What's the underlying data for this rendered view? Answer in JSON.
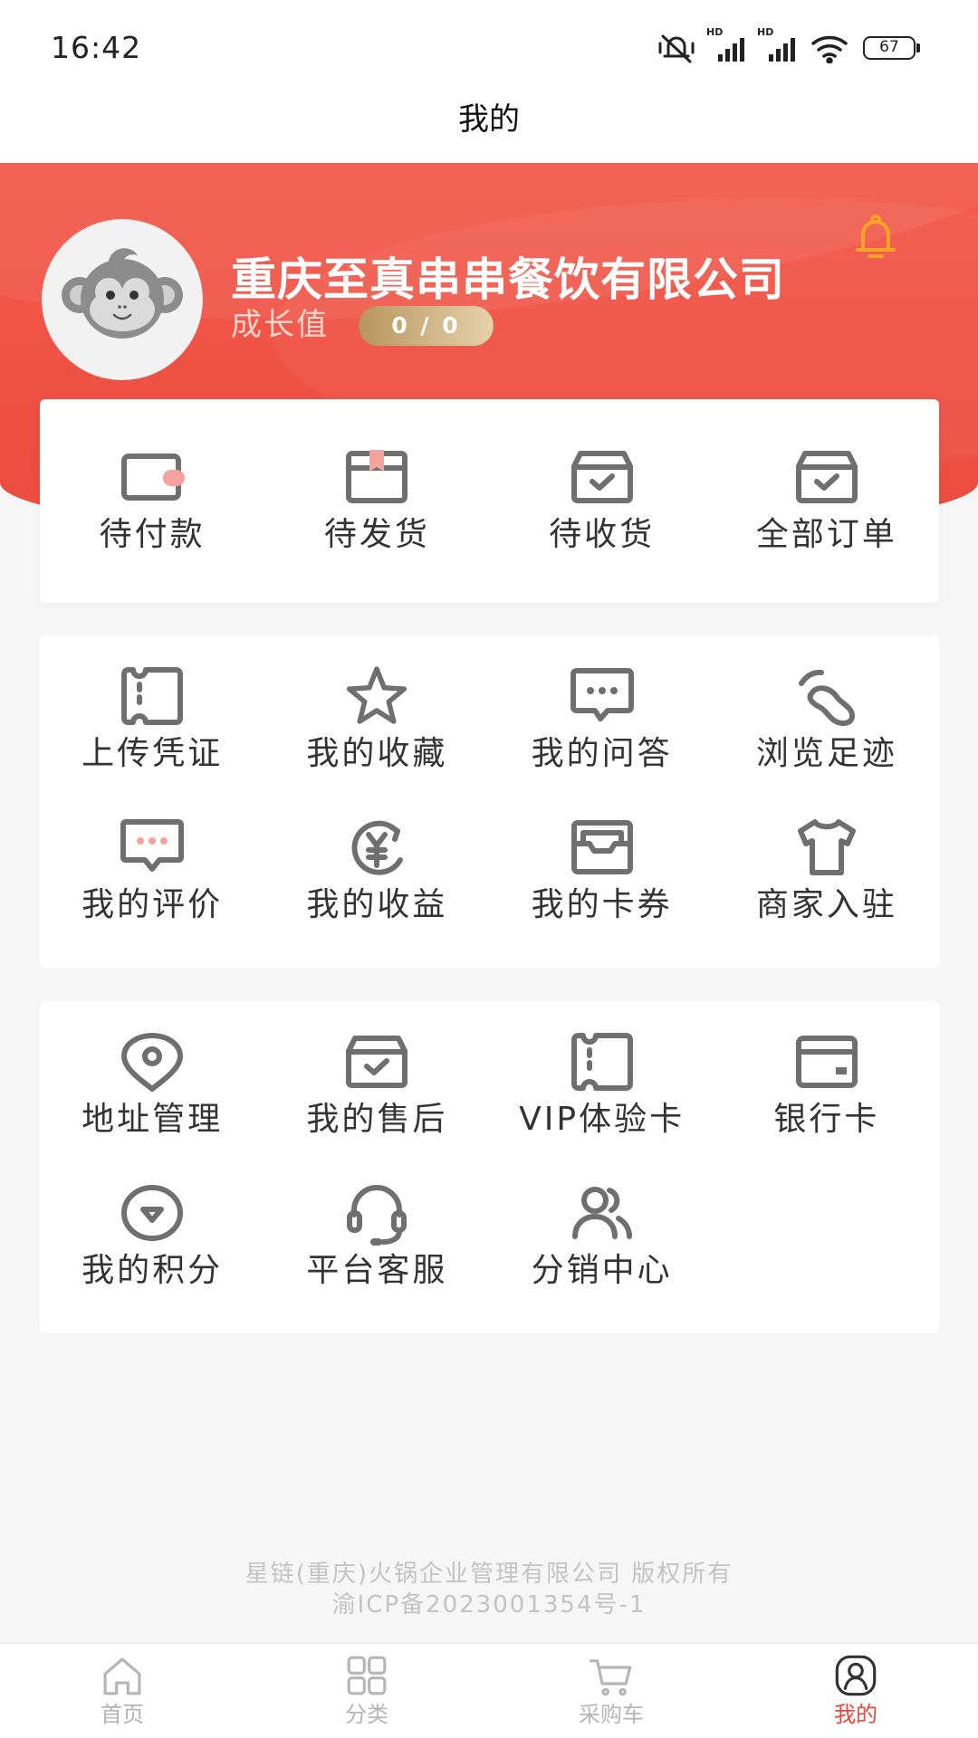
{
  "status_bar": {
    "time": "16:42",
    "icons": [
      "mute-icon",
      "signal-icon",
      "signal-icon",
      "wifi-icon",
      "battery-icon"
    ],
    "network_labels": [
      "HD",
      "HD"
    ],
    "battery_level": "67"
  },
  "header": {
    "title": "我的"
  },
  "profile": {
    "avatar_icon": "monkey-avatar",
    "company_name": "重庆至真串串餐饮有限公司",
    "growth_label": "成长值",
    "growth_value": "0 / 0",
    "notification_icon": "bell-icon"
  },
  "orders": {
    "items": [
      {
        "label": "待付款",
        "icon": "wallet-icon"
      },
      {
        "label": "待发货",
        "icon": "package-icon"
      },
      {
        "label": "待收货",
        "icon": "box-check-icon"
      },
      {
        "label": "全部订单",
        "icon": "box-check-icon"
      }
    ]
  },
  "services": {
    "items": [
      {
        "label": "上传凭证",
        "icon": "ticket-icon"
      },
      {
        "label": "我的收藏",
        "icon": "star-icon"
      },
      {
        "label": "我的问答",
        "icon": "chat-dots-icon"
      },
      {
        "label": "浏览足迹",
        "icon": "footprint-icon"
      },
      {
        "label": "我的评价",
        "icon": "comment-icon"
      },
      {
        "label": "我的收益",
        "icon": "yen-icon"
      },
      {
        "label": "我的卡券",
        "icon": "coupon-icon"
      },
      {
        "label": "商家入驻",
        "icon": "shop-icon"
      }
    ]
  },
  "tools": {
    "items": [
      {
        "label": "地址管理",
        "icon": "location-pin-icon"
      },
      {
        "label": "我的售后",
        "icon": "box-check-icon"
      },
      {
        "label": "VIP体验卡",
        "icon": "ticket-icon"
      },
      {
        "label": "银行卡",
        "icon": "bank-card-icon"
      },
      {
        "label": "我的积分",
        "icon": "points-icon"
      },
      {
        "label": "平台客服",
        "icon": "headset-icon"
      },
      {
        "label": "分销中心",
        "icon": "users-icon"
      }
    ]
  },
  "footer": {
    "copyright": "星链(重庆)火锅企业管理有限公司 版权所有",
    "icp": "渝ICP备2023001354号-1"
  },
  "tabbar": {
    "items": [
      {
        "label": "首页",
        "icon": "home-icon",
        "active": false
      },
      {
        "label": "分类",
        "icon": "grid-icon",
        "active": false
      },
      {
        "label": "采购车",
        "icon": "cart-icon",
        "active": false
      },
      {
        "label": "我的",
        "icon": "profile-icon",
        "active": true
      }
    ]
  },
  "colors": {
    "brand_red": "#ea4b3e",
    "banner_top": "#f35b4c",
    "accent_gold": "#e6d2aa",
    "bell": "#f5a623",
    "icon_gray": "#6f6f6f",
    "icon_accent_pink": "#f3a39c",
    "tab_active": "#e8473b",
    "tab_inactive": "#b5b5b5",
    "page_bg": "#f6f6f6"
  }
}
